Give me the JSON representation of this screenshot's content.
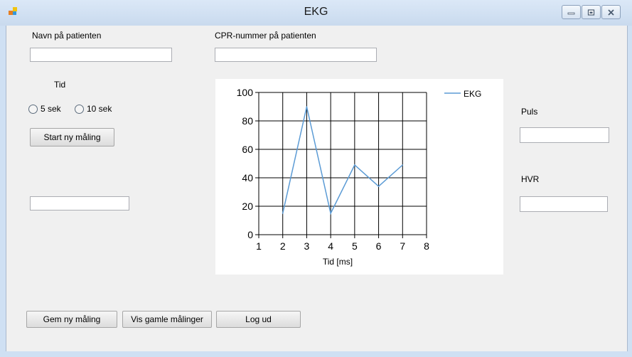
{
  "window": {
    "title": "EKG",
    "colors": {
      "titlebar": "#c9daee",
      "client": "#f0f0f0",
      "series": "#5b9bd5"
    }
  },
  "form": {
    "name_label": "Navn på patienten",
    "name_value": "",
    "cpr_label": "CPR-nummer på patienten",
    "cpr_value": "",
    "time_label": "Tid",
    "radio_5": "5 sek",
    "radio_10": "10 sek",
    "start_button": "Start ny måling",
    "result_value": "",
    "puls_label": "Puls",
    "puls_value": "",
    "hvr_label": "HVR",
    "hvr_value": "",
    "save_button": "Gem ny måling",
    "show_old_button": "Vis gamle målinger",
    "logout_button": "Log ud"
  },
  "chart_data": {
    "type": "line",
    "title": "",
    "xlabel": "Tid [ms]",
    "ylabel": "",
    "xlim": [
      1,
      8
    ],
    "ylim": [
      0,
      100
    ],
    "xticks": [
      "1",
      "2",
      "3",
      "4",
      "5",
      "6",
      "7",
      "8"
    ],
    "yticks": [
      "0",
      "20",
      "40",
      "60",
      "80",
      "100"
    ],
    "grid": true,
    "legend": "top-right",
    "series": [
      {
        "name": "EKG",
        "x": [
          2,
          3,
          4,
          5,
          6,
          7
        ],
        "values": [
          15,
          90,
          15,
          49,
          34,
          49
        ]
      }
    ]
  }
}
